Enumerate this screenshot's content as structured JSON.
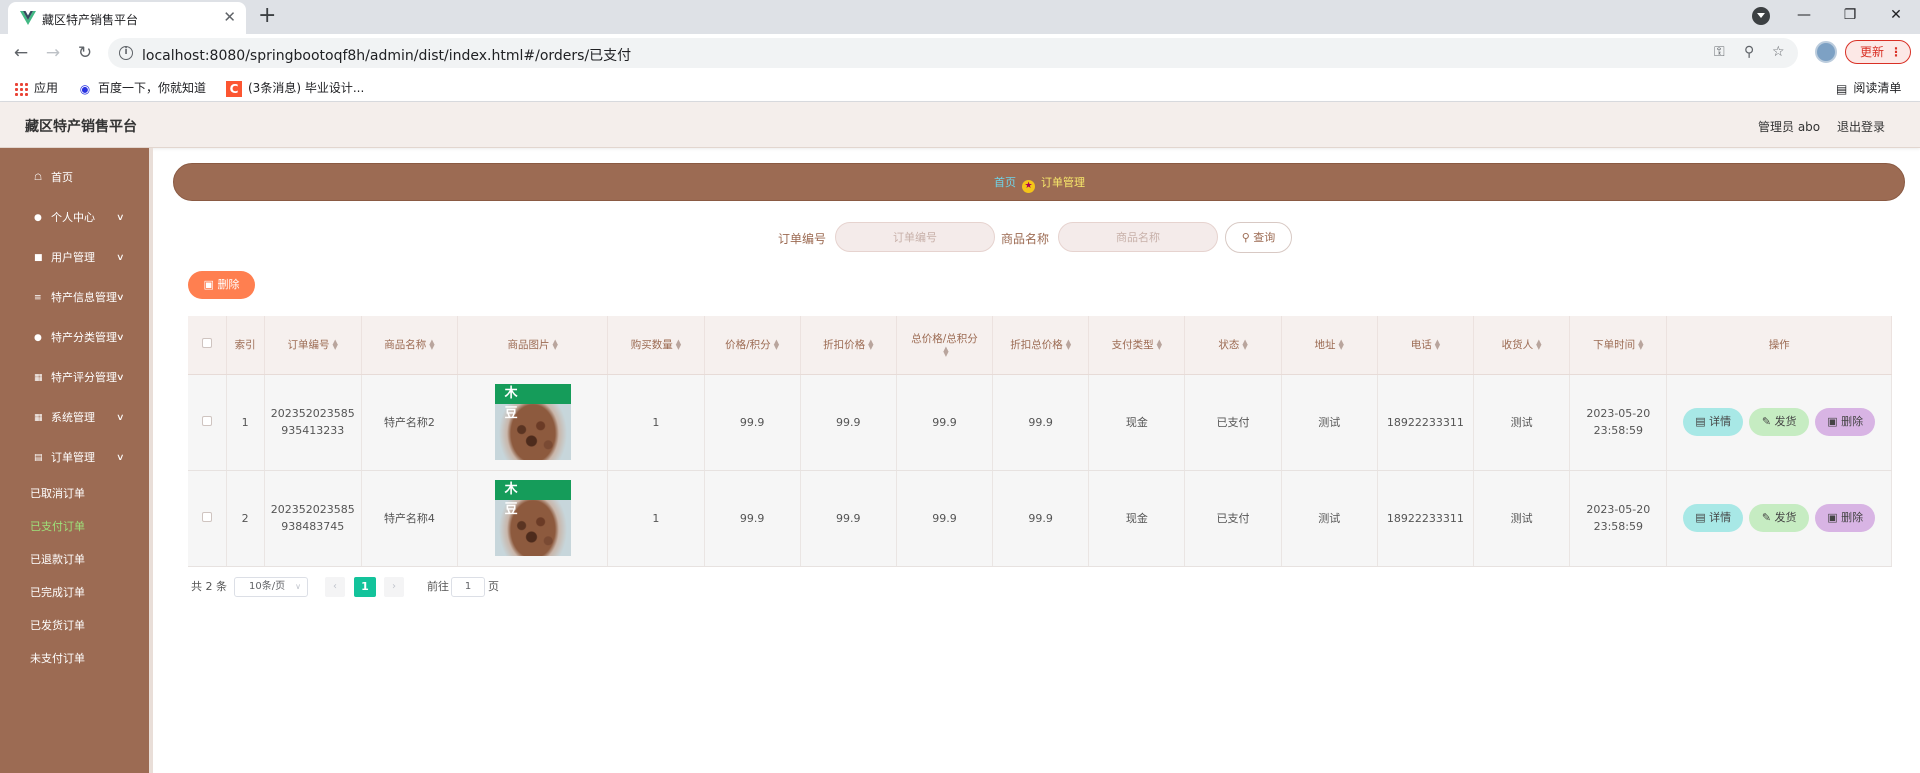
{
  "browser": {
    "tab_title": "藏区特产销售平台",
    "tab_close": "✕",
    "new_tab": "+",
    "url": "localhost:8080/springbootoqf8h/admin/dist/index.html#/orders/已支付",
    "update_label": "更新",
    "bookmarks": [
      {
        "label": "应用",
        "icon": "apps-grid-icon"
      },
      {
        "label": "百度一下，你就知道",
        "icon": "baidu-paw-icon"
      },
      {
        "label": "(3条消息) 毕业设计...",
        "icon": "csdn-c-icon"
      }
    ],
    "reading_list": "阅读清单"
  },
  "header": {
    "title": "藏区特产销售平台",
    "admin_label": "管理员 abo",
    "logout_label": "退出登录"
  },
  "sidebar": {
    "items": [
      {
        "label": "首页",
        "icon": "home-icon",
        "has_arrow": false
      },
      {
        "label": "个人中心",
        "icon": "user-icon",
        "has_arrow": true
      },
      {
        "label": "用户管理",
        "icon": "briefcase-icon",
        "has_arrow": true
      },
      {
        "label": "特产信息管理",
        "icon": "sliders-icon",
        "has_arrow": true
      },
      {
        "label": "特产分类管理",
        "icon": "user-icon",
        "has_arrow": true
      },
      {
        "label": "特产评分管理",
        "icon": "grid-icon",
        "has_arrow": true
      },
      {
        "label": "系统管理",
        "icon": "grid-icon",
        "has_arrow": true
      },
      {
        "label": "订单管理",
        "icon": "document-icon",
        "has_arrow": true
      }
    ],
    "sub_items": [
      {
        "label": "已取消订单",
        "active": false
      },
      {
        "label": "已支付订单",
        "active": true
      },
      {
        "label": "已退款订单",
        "active": false
      },
      {
        "label": "已完成订单",
        "active": false
      },
      {
        "label": "已发货订单",
        "active": false
      },
      {
        "label": "未支付订单",
        "active": false
      }
    ]
  },
  "breadcrumb": {
    "home": "首页",
    "current": "订单管理"
  },
  "search": {
    "order_no_label": "订单编号",
    "order_no_placeholder": "订单编号",
    "order_no_value": "",
    "product_name_label": "商品名称",
    "product_name_placeholder": "商品名称",
    "product_name_value": "",
    "query_label": "查询"
  },
  "actions": {
    "delete_label": "删除"
  },
  "table": {
    "columns": [
      "索引",
      "订单编号",
      "商品名称",
      "商品图片",
      "购买数量",
      "价格/积分",
      "折扣价格",
      "总价格/总积分",
      "折扣总价格",
      "支付类型",
      "状态",
      "地址",
      "电话",
      "收货人",
      "下单时间",
      "操作"
    ],
    "rows": [
      {
        "index": "1",
        "order_no": "202352023585935413233",
        "product_name": "特产名称2",
        "image_caption": "木 豆",
        "quantity": "1",
        "price": "99.9",
        "discount_price": "99.9",
        "total": "99.9",
        "discount_total": "99.9",
        "pay_type": "现金",
        "status": "已支付",
        "address": "测试",
        "phone": "18922233311",
        "receiver": "测试",
        "order_time": "2023-05-20 23:58:59"
      },
      {
        "index": "2",
        "order_no": "202352023585938483745",
        "product_name": "特产名称4",
        "image_caption": "木 豆",
        "quantity": "1",
        "price": "99.9",
        "discount_price": "99.9",
        "total": "99.9",
        "discount_total": "99.9",
        "pay_type": "现金",
        "status": "已支付",
        "address": "测试",
        "phone": "18922233311",
        "receiver": "测试",
        "order_time": "2023-05-20 23:58:59"
      }
    ],
    "row_actions": {
      "detail": "详情",
      "ship": "发货",
      "delete": "删除"
    }
  },
  "pagination": {
    "total_text": "共 2 条",
    "page_size": "10条/页",
    "current_page": "1",
    "goto_prefix": "前往",
    "goto_value": "1",
    "goto_suffix": "页"
  },
  "colors": {
    "brand_brown": "#9c6b53",
    "accent_orange": "#ff7f50",
    "active_page": "#13c39b",
    "active_submenu": "#9ee27a"
  }
}
